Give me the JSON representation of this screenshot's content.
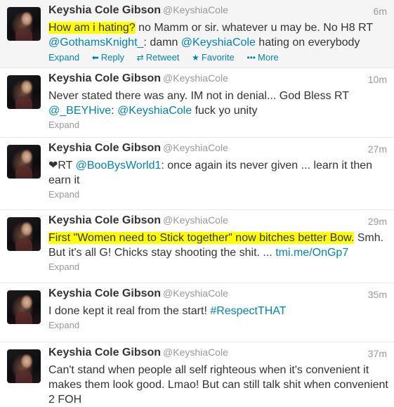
{
  "tweets": [
    {
      "fullname": "Keyshia Cole Gibson",
      "username": "@KeyshiaCole",
      "time": "6m",
      "lines": [
        [
          {
            "text": "How am i hating?",
            "type": "highlight"
          },
          {
            "text": " no Mamm or sir. whatever u may be. No H8  RT",
            "type": "plain"
          }
        ],
        [
          {
            "text": "@GothamsKnight_",
            "type": "link"
          },
          {
            "text": ": damn ",
            "type": "plain"
          },
          {
            "text": "@KeyshiaCole",
            "type": "link"
          },
          {
            "text": " hating on everybody",
            "type": "plain"
          }
        ]
      ],
      "actions": {
        "expand": "Expand",
        "reply": "Reply",
        "retweet": "Retweet",
        "favorite": "Favorite",
        "more": "More"
      }
    },
    {
      "fullname": "Keyshia Cole Gibson",
      "username": "@KeyshiaCole",
      "time": "10m",
      "lines": [
        [
          {
            "text": "Never stated there was any. IM not in denial... God Bless RT",
            "type": "plain"
          }
        ],
        [
          {
            "text": "@_BEYHive",
            "type": "link"
          },
          {
            "text": ": ",
            "type": "plain"
          },
          {
            "text": "@KeyshiaCole",
            "type": "link"
          },
          {
            "text": " fuck yo unity",
            "type": "plain"
          }
        ]
      ],
      "expand": "Expand"
    },
    {
      "fullname": "Keyshia Cole Gibson",
      "username": "@KeyshiaCole",
      "time": "27m",
      "lines": [
        [
          {
            "text": "❤RT ",
            "type": "plain"
          },
          {
            "text": "@BooBysWorld1",
            "type": "link"
          },
          {
            "text": ": once again its never given ... learn it then",
            "type": "plain"
          }
        ],
        [
          {
            "text": "earn it",
            "type": "plain"
          }
        ]
      ],
      "expand": "Expand"
    },
    {
      "fullname": "Keyshia Cole Gibson",
      "username": "@KeyshiaCole",
      "time": "29m",
      "lines": [
        [
          {
            "text": "First \"Women need to Stick together\" now bitches better Bow.",
            "type": "highlight"
          },
          {
            "text": " Smh.",
            "type": "plain"
          }
        ],
        [
          {
            "text": "But it's all G! Chicks stay shooting the shit. ... ",
            "type": "plain"
          },
          {
            "text": "tmi.me/OnGp7",
            "type": "link"
          }
        ]
      ],
      "expand": "Expand"
    },
    {
      "fullname": "Keyshia Cole Gibson",
      "username": "@KeyshiaCole",
      "time": "35m",
      "lines": [
        [
          {
            "text": "I done kept it real from the start! ",
            "type": "plain"
          },
          {
            "text": "#RespectTHAT",
            "type": "link"
          }
        ]
      ],
      "expand": "Expand"
    },
    {
      "fullname": "Keyshia Cole Gibson",
      "username": "@KeyshiaCole",
      "time": "37m",
      "lines": [
        [
          {
            "text": "Can't stand when people all self righteous when it's convenient it",
            "type": "plain"
          }
        ],
        [
          {
            "text": "makes them look good. Lmao! But can still talk shit when convenient",
            "type": "plain"
          }
        ],
        [
          {
            "text": "2 FOH",
            "type": "plain"
          }
        ]
      ]
    }
  ],
  "colors": {
    "link": "#0084b4",
    "highlight": "#ffff00",
    "muted": "#999999",
    "text": "#333333",
    "hover_background": "#f5f5f5"
  },
  "icons": {
    "reply": "reply-arrow-icon",
    "retweet": "retweet-icon",
    "favorite": "star-icon",
    "more": "ellipsis-icon"
  }
}
